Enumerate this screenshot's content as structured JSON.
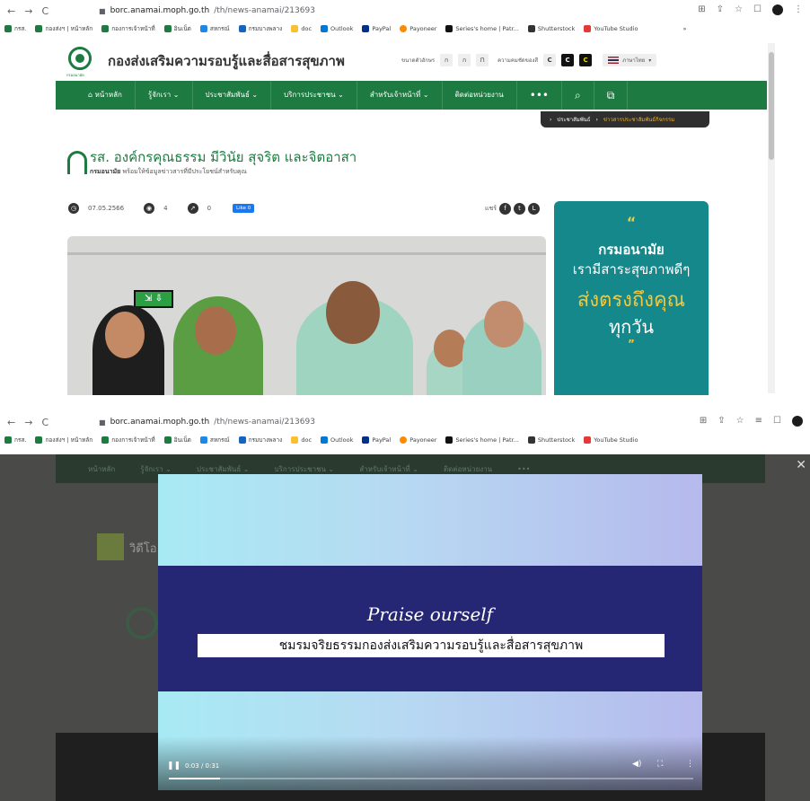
{
  "browser": {
    "url_host": "borc.anamai.moph.go.th",
    "url_path": "/th/news-anamai/213693",
    "bookmarks": [
      "กรส.",
      "กองส่งฯ | หน้าหลัก",
      "กองการเจ้าหน้าที่",
      "อินเน็ต",
      "สหกรณ์",
      "กรมบางพลาง",
      "doc",
      "Outlook",
      "PayPal",
      "Payoneer",
      "Series's home | Patr...",
      "Shutterstock",
      "YouTube Studio"
    ],
    "more_bookmarks": "»"
  },
  "site": {
    "title": "กองส่งเสริมความรอบรู้และสื่อสารสุขภาพ",
    "logo_caption": "กรมอนามัย",
    "font_size_label": "ขนาดตัวอักษร",
    "font_sizes": [
      "ก",
      "ก",
      "ก"
    ],
    "contrast_label": "ความคมชัดของสี",
    "contrast_options": [
      "C",
      "C",
      "C"
    ],
    "language": "ภาษาไทย"
  },
  "nav": {
    "items": [
      "หน้าหลัก",
      "รู้จักเรา ⌄",
      "ประชาสัมพันธ์ ⌄",
      "บริการประชาชน ⌄",
      "สำหรับเจ้าหน้าที่ ⌄",
      "ติดต่อหน่วยงาน"
    ],
    "more": "•••"
  },
  "breadcrumb": {
    "items": [
      "ประชาสัมพันธ์",
      "ข่าวสารประชาสัมพันธ์กิจกรรม"
    ]
  },
  "article": {
    "title": "รส. องค์กรคุณธรรม มีวินัย สุจริต และจิตอาสา",
    "subtitle_bold": "กรมอนามัย",
    "subtitle": "พร้อมให้ข้อมูลข่าวสารที่มีประโยชน์สำหรับคุณ",
    "date": "07.05.2566",
    "views": "4",
    "shares": "0",
    "like_label": "Like 0",
    "share_label": "แชร์"
  },
  "promo": {
    "open_quote": "“",
    "line1": "กรมอนามัย",
    "line2": "เรามีสาระสุขภาพดีๆ",
    "line3": "ส่งตรงถึงคุณ",
    "line4": "ทุกวัน",
    "close_quote": "”"
  },
  "video_overlay": {
    "close": "✕",
    "section_heading": "วิดีโอ",
    "video_title": "Praise ourself",
    "video_caption": "ชมรมจริยธรรมกองส่งเสริมความรอบรู้และสื่อสารสุขภาพ",
    "time": "0:03 / 0:31",
    "progress": 0.097
  },
  "colors": {
    "brand_green": "#1d7a40",
    "promo_teal": "#14888a",
    "promo_accent": "#f3c83a",
    "video_band": "#262774"
  }
}
